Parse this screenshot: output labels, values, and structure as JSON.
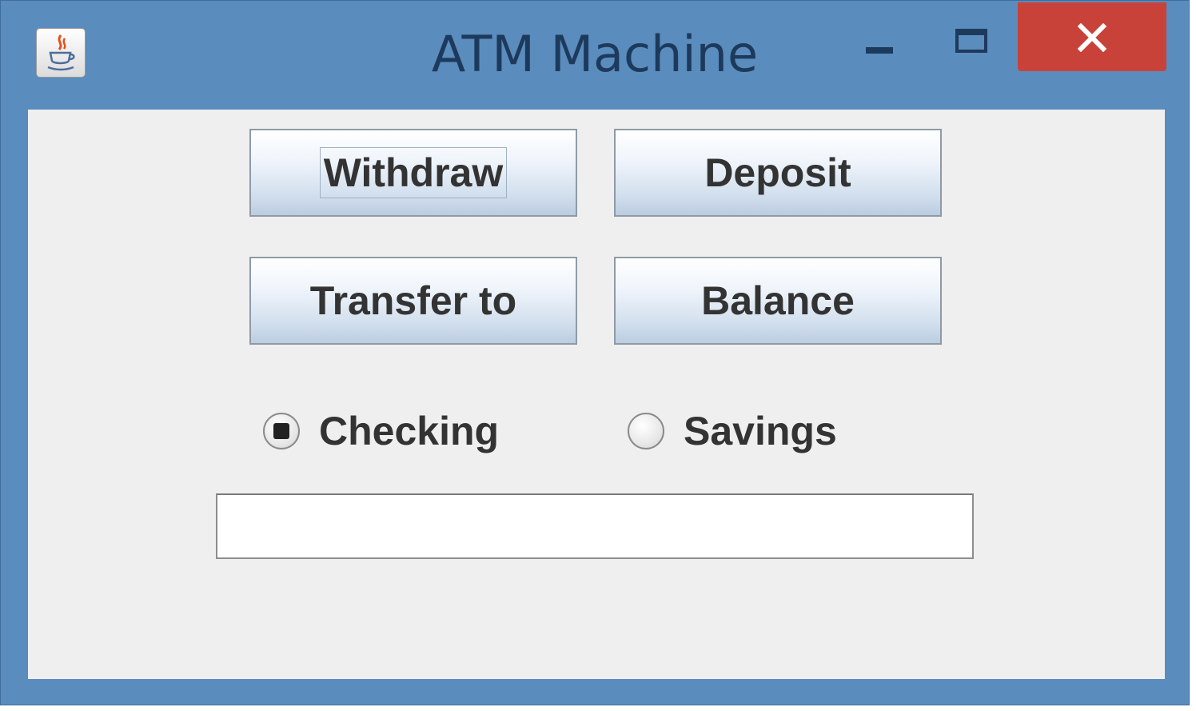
{
  "window": {
    "title": "ATM Machine",
    "icon": "java-cup-icon",
    "controls": {
      "minimize": "minimize-icon",
      "maximize": "maximize-icon",
      "close": "close-icon"
    },
    "colors": {
      "frame": "#5a8cbd",
      "close_button": "#c9423a",
      "client_background": "#efefef"
    }
  },
  "buttons": {
    "withdraw": "Withdraw",
    "deposit": "Deposit",
    "transfer": "Transfer to",
    "balance": "Balance"
  },
  "accounts": {
    "checking": "Checking",
    "savings": "Savings",
    "selected": "Checking"
  },
  "amount_field": {
    "value": ""
  }
}
